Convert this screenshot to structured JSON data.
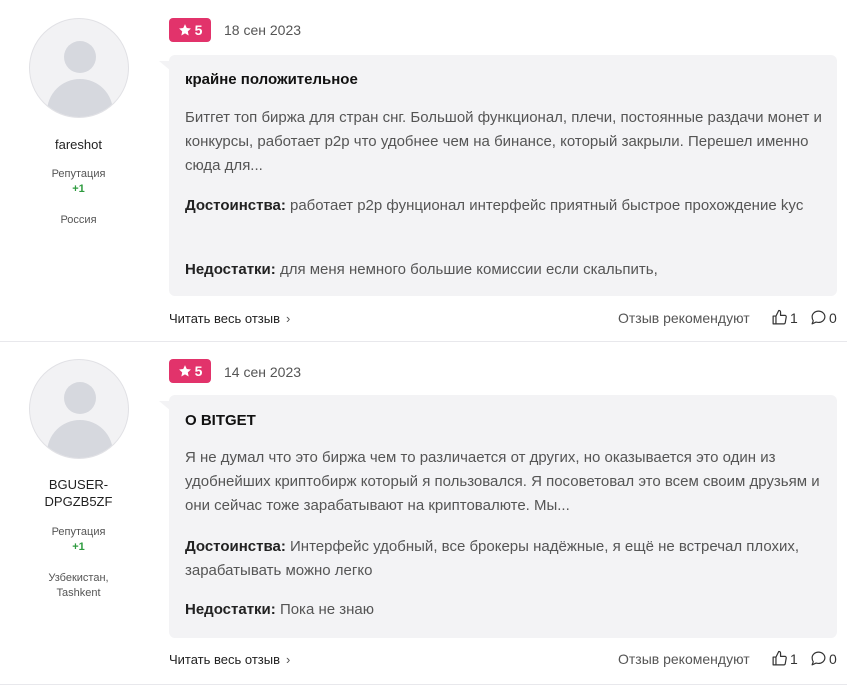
{
  "reviews": [
    {
      "author": {
        "name": "fareshot",
        "reputation_label": "Репутация",
        "reputation_value": "+1",
        "location": "Россия"
      },
      "rating": "5",
      "date": "18 сен 2023",
      "title": "крайне положительное",
      "body": "Битгет топ биржа для стран снг. Большой функционал, плечи, постоянные раздачи монет и конкурсы, работает p2p что удобнее чем на бинансе, который закрыли. Перешел именно сюда для...",
      "pros_label": "Достоинства:",
      "pros": "работает p2p фунционал интерфейс приятный быстрое прохождение kyc",
      "cons_label": "Недостатки:",
      "cons": "для меня немного большие комиссии если скальпить,",
      "read_more": "Читать весь отзыв",
      "recommend_label": "Отзыв рекомендуют",
      "likes": "1",
      "comments": "0"
    },
    {
      "author": {
        "name": "BGUSER-DPGZB5ZF",
        "reputation_label": "Репутация",
        "reputation_value": "+1",
        "location": "Узбекистан, Tashkent"
      },
      "rating": "5",
      "date": "14 сен 2023",
      "title": "О BITGET",
      "body": "Я не думал что это биржа чем то различается от других, но оказывается это один из удобнейших криптобирж который я пользовался. Я посоветовал это всем своим друзьям и они сейчас тоже зарабатывают на криптовалюте. Мы...",
      "pros_label": "Достоинства:",
      "pros": "Интерфейс удобный, все брокеры надёжные, я ещё не встречал плохих, зарабатывать можно легко",
      "cons_label": "Недостатки:",
      "cons": "Пока не знаю",
      "read_more": "Читать весь отзыв",
      "recommend_label": "Отзыв рекомендуют",
      "likes": "1",
      "comments": "0"
    }
  ],
  "icons": {
    "star": "star-icon",
    "chevron": "chevron-right-icon",
    "like": "thumbs-up-icon",
    "comment": "comment-icon"
  },
  "colors": {
    "badge": "#e2336b",
    "reputation": "#2e9b3f",
    "bubble": "#f3f3f5"
  }
}
